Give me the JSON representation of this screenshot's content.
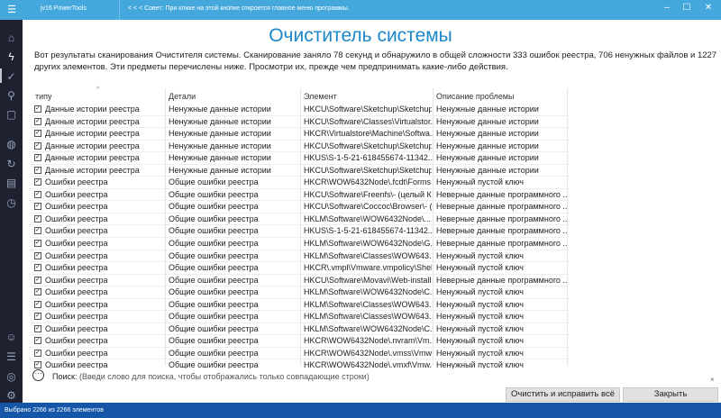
{
  "titlebar": {
    "app_name": "jv16 PowerTools",
    "tip": "< < < Совет: При клике на этой кнопке откроется главное меню программы.",
    "minimize": "–",
    "maximize": "☐",
    "close": "✕"
  },
  "main": {
    "title": "Очиститель системы",
    "intro": "Вот результаты сканирования Очистителя системы. Сканирование заняло 78 секунд и обнаружило в общей сложности 333 ошибок реестра, 706 ненужных файлов и 1227 других элементов. Эти предметы перечислены ниже. Просмотри их, прежде чем предпринимать какие-либо действия."
  },
  "table": {
    "columns": [
      "типу",
      "Детали",
      "Элемент",
      "Описание проблемы"
    ],
    "rows": [
      [
        "Данные истории реестра",
        "Ненужные данные истории",
        "HKCU\\Software\\Sketchup\\Sketchup...",
        "Ненужные данные истории"
      ],
      [
        "Данные истории реестра",
        "Ненужные данные истории",
        "HKCU\\Software\\Classes\\Virtualstor...",
        "Ненужные данные истории"
      ],
      [
        "Данные истории реестра",
        "Ненужные данные истории",
        "HKCR\\Virtualstore\\Machine\\Softwa...",
        "Ненужные данные истории"
      ],
      [
        "Данные истории реестра",
        "Ненужные данные истории",
        "HKCU\\Software\\Sketchup\\Sketchup...",
        "Ненужные данные истории"
      ],
      [
        "Данные истории реестра",
        "Ненужные данные истории",
        "HKUS\\S-1-5-21-618455674-11342...",
        "Ненужные данные истории"
      ],
      [
        "Данные истории реестра",
        "Ненужные данные истории",
        "HKCU\\Software\\Sketchup\\Sketchup...",
        "Ненужные данные истории"
      ],
      [
        "Ошибки реестра",
        "Общие ошибки реестра",
        "HKCR\\WOW6432Node\\.fcdt\\Forms...",
        "Ненужный пустой ключ"
      ],
      [
        "Ошибки реестра",
        "Общие ошибки реестра",
        "HKCU\\Software\\Freenfs\\- (целый К...",
        "Неверные данные программного ..."
      ],
      [
        "Ошибки реестра",
        "Общие ошибки реестра",
        "HKCU\\Software\\Coccoc\\Browser\\- (...",
        "Неверные данные программного ..."
      ],
      [
        "Ошибки реестра",
        "Общие ошибки реестра",
        "HKLM\\Software\\WOW6432Node\\...",
        "Неверные данные программного ..."
      ],
      [
        "Ошибки реестра",
        "Общие ошибки реестра",
        "HKUS\\S-1-5-21-618455674-11342...",
        "Неверные данные программного ..."
      ],
      [
        "Ошибки реестра",
        "Общие ошибки реестра",
        "HKLM\\Software\\WOW6432Node\\G...",
        "Неверные данные программного ..."
      ],
      [
        "Ошибки реестра",
        "Общие ошибки реестра",
        "HKLM\\Software\\Classes\\WOW643...",
        "Ненужный пустой ключ"
      ],
      [
        "Ошибки реестра",
        "Общие ошибки реестра",
        "HKCR\\.vmpl\\Vmware.vmpolicy\\Shel...",
        "Ненужный пустой ключ"
      ],
      [
        "Ошибки реестра",
        "Общие ошибки реестра",
        "HKCU\\Software\\Movavi\\Web-install...",
        "Неверные данные программного ..."
      ],
      [
        "Ошибки реестра",
        "Общие ошибки реестра",
        "HKLM\\Software\\WOW6432Node\\C...",
        "Ненужный пустой ключ"
      ],
      [
        "Ошибки реестра",
        "Общие ошибки реестра",
        "HKLM\\Software\\Classes\\WOW643...",
        "Ненужный пустой ключ"
      ],
      [
        "Ошибки реестра",
        "Общие ошибки реестра",
        "HKLM\\Software\\Classes\\WOW643...",
        "Ненужный пустой ключ"
      ],
      [
        "Ошибки реестра",
        "Общие ошибки реестра",
        "HKLM\\Software\\WOW6432Node\\C...",
        "Ненужный пустой ключ"
      ],
      [
        "Ошибки реестра",
        "Общие ошибки реестра",
        "HKCR\\WOW6432Node\\.nvram\\Vm...",
        "Ненужный пустой ключ"
      ],
      [
        "Ошибки реестра",
        "Общие ошибки реестра",
        "HKCR\\WOW6432Node\\.vmss\\Vmw...",
        "Ненужный пустой ключ"
      ],
      [
        "Ошибки реестра",
        "Общие ошибки реестра",
        "HKCR\\WOW6432Node\\.vmxf\\Vmw...",
        "Ненужный пустой ключ"
      ]
    ]
  },
  "search": {
    "label": "Поиск:",
    "placeholder": "(Введи слово для поиска, чтобы отображались только совпадающие строки)",
    "clear": "×"
  },
  "buttons": {
    "fix_all": "Очистить и исправить всё",
    "close": "Закрыть"
  },
  "status": {
    "text": "Выбрано 2266 из 2266 элементов"
  }
}
